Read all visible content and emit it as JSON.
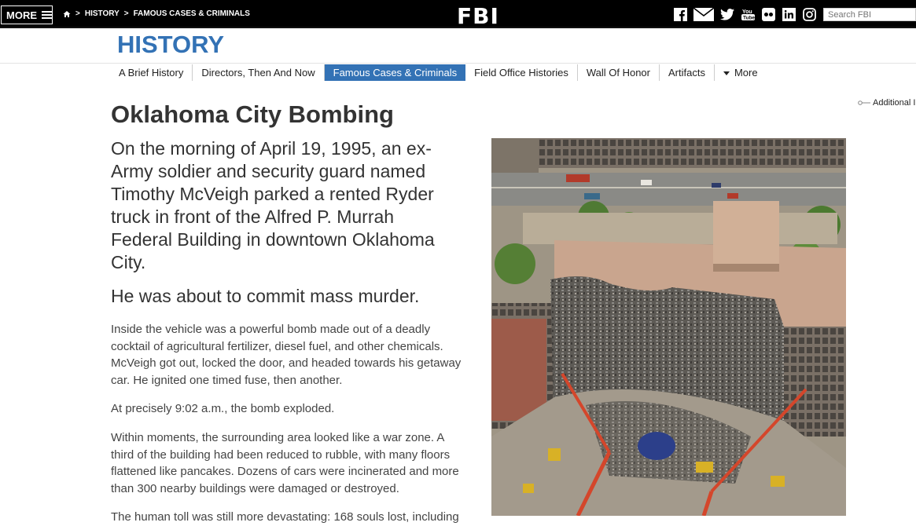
{
  "topbar": {
    "more_label": "MORE",
    "breadcrumbs": [
      "HISTORY",
      "FAMOUS CASES & CRIMINALS"
    ],
    "logo": "FBI",
    "social_icons": [
      "facebook-icon",
      "email-icon",
      "twitter-icon",
      "youtube-icon",
      "flickr-icon",
      "linkedin-icon",
      "instagram-icon"
    ],
    "search_placeholder": "Search FBI"
  },
  "section": {
    "title": "HISTORY",
    "color": "#3372b5"
  },
  "subnav": {
    "items": [
      "A Brief History",
      "Directors, Then And Now",
      "Famous Cases & Criminals",
      "Field Office Histories",
      "Wall Of Honor",
      "Artifacts"
    ],
    "active_index": 2,
    "more_label": "More"
  },
  "sidebar": {
    "additional_label": "Additional In"
  },
  "article": {
    "title": "Oklahoma City Bombing",
    "lead": "On the morning of April 19, 1995, an ex-Army soldier and security guard named Timothy McVeigh parked a rented Ryder truck in front of the Alfred P. Murrah Federal Building in downtown Oklahoma City.",
    "lead2": "He was about to commit mass murder.",
    "paragraphs": [
      "Inside the vehicle was a powerful bomb made out of a deadly cocktail of agricultural fertilizer, diesel fuel, and other chemicals. McVeigh got out, locked the door, and headed towards his getaway car. He ignited one timed fuse, then another.",
      "At precisely 9:02 a.m., the bomb exploded.",
      "Within moments, the surrounding area looked like a war zone. A third of the building had been reduced to rubble, with many floors flattened like pancakes. Dozens of cars were incinerated and more than 300 nearby buildings were damaged or destroyed.",
      "The human toll was still more devastating: 168 souls lost, including"
    ]
  }
}
